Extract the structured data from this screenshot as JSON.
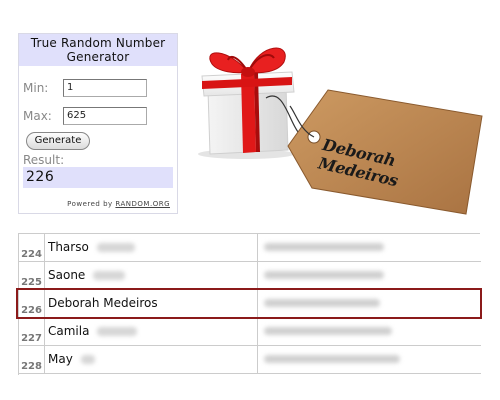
{
  "rng": {
    "title": "True Random Number Generator",
    "min_label": "Min:",
    "min_value": "1",
    "max_label": "Max:",
    "max_value": "625",
    "generate_label": "Generate",
    "result_label": "Result:",
    "result_value": "226",
    "powered_prefix": "Powered by",
    "powered_link": "RANDOM.ORG"
  },
  "tag": {
    "name": "Deborah Medeiros"
  },
  "table": {
    "rows": [
      {
        "number": "224",
        "name": "Tharso"
      },
      {
        "number": "225",
        "name": "Saone"
      },
      {
        "number": "226",
        "name": "Deborah Medeiros",
        "highlighted": true
      },
      {
        "number": "227",
        "name": "Camila"
      },
      {
        "number": "228",
        "name": "May"
      }
    ]
  },
  "colors": {
    "widget_header_bg": "#e0e0fb",
    "highlight_border": "#8b1a1a",
    "ribbon_red": "#e01818",
    "tag_brown": "#c08a54"
  }
}
